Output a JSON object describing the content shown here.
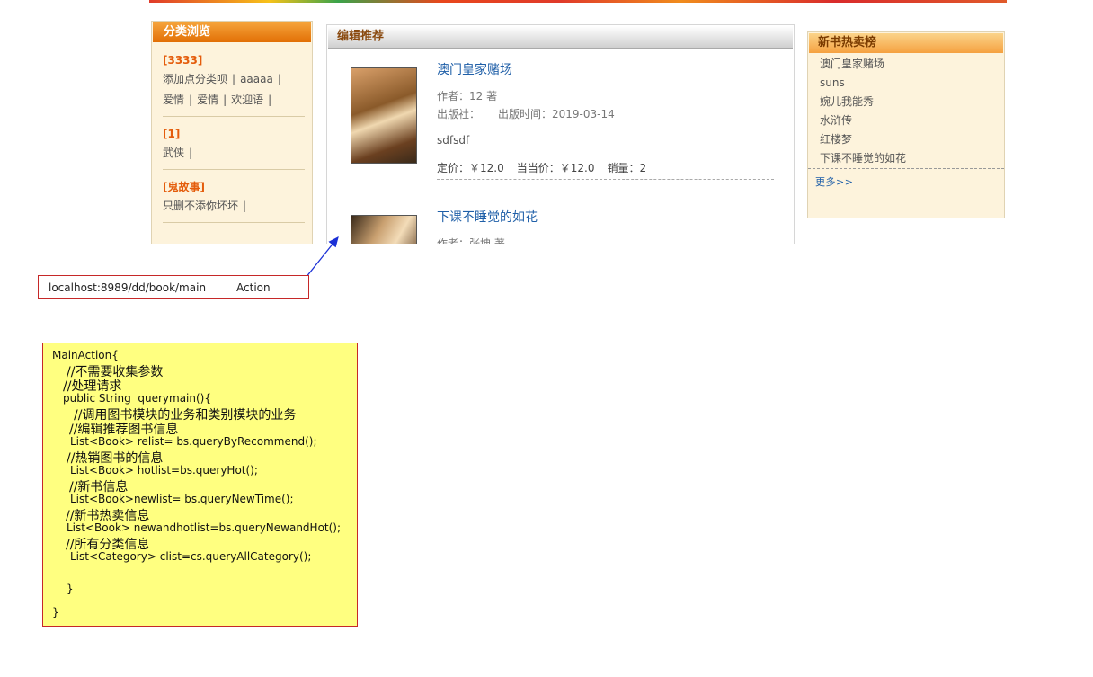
{
  "category_box": {
    "title": "分类浏览",
    "groups": [
      {
        "name": "[3333]",
        "items": [
          "添加点分类呗",
          "aaaaa",
          "爱情",
          "爱情",
          "欢迎语"
        ]
      },
      {
        "name": "[1]",
        "items": [
          "武侠"
        ]
      },
      {
        "name": "[鬼故事]",
        "items": [
          "只删不添你坏坏"
        ]
      }
    ]
  },
  "recommend": {
    "title": "编辑推荐",
    "books": [
      {
        "title": "澳门皇家赌场",
        "author": "作者：12 著",
        "publisher": "出版社：",
        "pub_date": "出版时间：2019-03-14",
        "desc": "sdfsdf",
        "price": "定价：￥12.0",
        "current_price": "当当价：￥12.0",
        "sales": "销量：2"
      },
      {
        "title": "下课不睡觉的如花",
        "author": "作者：张坤 著"
      }
    ]
  },
  "hot_box": {
    "title": "新书热卖榜",
    "items": [
      "澳门皇家赌场",
      "suns",
      "婉儿我能秀",
      "水浒传",
      "红楼梦",
      "下课不睡觉的如花"
    ],
    "more": "更多>>"
  },
  "annotation": {
    "url": "localhost:8989/dd/book/main",
    "action": "Action"
  },
  "code_note": {
    "lines": [
      "MainAction{",
      "//不需要收集参数",
      "//处理请求",
      "public String  querymain(){",
      "//调用图书模块的业务和类别模块的业务",
      "//编辑推荐图书信息",
      "List<Book> relist= bs.queryByRecommend();",
      "//热销图书的信息",
      "List<Book> hotlist=bs.queryHot();",
      "//新书信息",
      "List<Book>newlist= bs.queryNewTime();",
      "//新书热卖信息",
      "List<Book> newandhotlist=bs.queryNewandHot();",
      "//所有分类信息",
      "List<Category> clist=cs.queryAllCategory();",
      "}",
      "}"
    ]
  },
  "colors": {
    "category_header": "#e26f05",
    "category_text": "#e45c0b",
    "link_blue": "#1f5fa8",
    "note_yellow": "#ffff80",
    "annotation_red": "#c62828",
    "arrow_blue": "#1a2fd6"
  }
}
